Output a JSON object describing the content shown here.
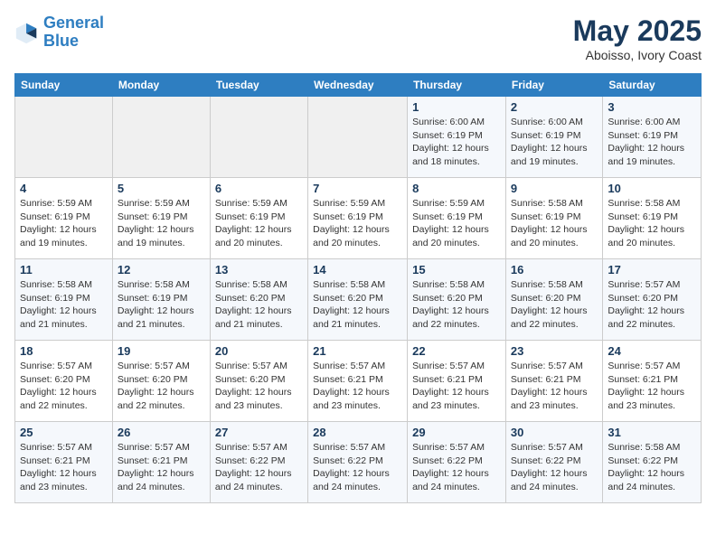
{
  "header": {
    "logo_line1": "General",
    "logo_line2": "Blue",
    "title": "May 2025",
    "subtitle": "Aboisso, Ivory Coast"
  },
  "days_of_week": [
    "Sunday",
    "Monday",
    "Tuesday",
    "Wednesday",
    "Thursday",
    "Friday",
    "Saturday"
  ],
  "weeks": [
    [
      {
        "num": "",
        "info": ""
      },
      {
        "num": "",
        "info": ""
      },
      {
        "num": "",
        "info": ""
      },
      {
        "num": "",
        "info": ""
      },
      {
        "num": "1",
        "info": "Sunrise: 6:00 AM\nSunset: 6:19 PM\nDaylight: 12 hours\nand 18 minutes."
      },
      {
        "num": "2",
        "info": "Sunrise: 6:00 AM\nSunset: 6:19 PM\nDaylight: 12 hours\nand 19 minutes."
      },
      {
        "num": "3",
        "info": "Sunrise: 6:00 AM\nSunset: 6:19 PM\nDaylight: 12 hours\nand 19 minutes."
      }
    ],
    [
      {
        "num": "4",
        "info": "Sunrise: 5:59 AM\nSunset: 6:19 PM\nDaylight: 12 hours\nand 19 minutes."
      },
      {
        "num": "5",
        "info": "Sunrise: 5:59 AM\nSunset: 6:19 PM\nDaylight: 12 hours\nand 19 minutes."
      },
      {
        "num": "6",
        "info": "Sunrise: 5:59 AM\nSunset: 6:19 PM\nDaylight: 12 hours\nand 20 minutes."
      },
      {
        "num": "7",
        "info": "Sunrise: 5:59 AM\nSunset: 6:19 PM\nDaylight: 12 hours\nand 20 minutes."
      },
      {
        "num": "8",
        "info": "Sunrise: 5:59 AM\nSunset: 6:19 PM\nDaylight: 12 hours\nand 20 minutes."
      },
      {
        "num": "9",
        "info": "Sunrise: 5:58 AM\nSunset: 6:19 PM\nDaylight: 12 hours\nand 20 minutes."
      },
      {
        "num": "10",
        "info": "Sunrise: 5:58 AM\nSunset: 6:19 PM\nDaylight: 12 hours\nand 20 minutes."
      }
    ],
    [
      {
        "num": "11",
        "info": "Sunrise: 5:58 AM\nSunset: 6:19 PM\nDaylight: 12 hours\nand 21 minutes."
      },
      {
        "num": "12",
        "info": "Sunrise: 5:58 AM\nSunset: 6:19 PM\nDaylight: 12 hours\nand 21 minutes."
      },
      {
        "num": "13",
        "info": "Sunrise: 5:58 AM\nSunset: 6:20 PM\nDaylight: 12 hours\nand 21 minutes."
      },
      {
        "num": "14",
        "info": "Sunrise: 5:58 AM\nSunset: 6:20 PM\nDaylight: 12 hours\nand 21 minutes."
      },
      {
        "num": "15",
        "info": "Sunrise: 5:58 AM\nSunset: 6:20 PM\nDaylight: 12 hours\nand 22 minutes."
      },
      {
        "num": "16",
        "info": "Sunrise: 5:58 AM\nSunset: 6:20 PM\nDaylight: 12 hours\nand 22 minutes."
      },
      {
        "num": "17",
        "info": "Sunrise: 5:57 AM\nSunset: 6:20 PM\nDaylight: 12 hours\nand 22 minutes."
      }
    ],
    [
      {
        "num": "18",
        "info": "Sunrise: 5:57 AM\nSunset: 6:20 PM\nDaylight: 12 hours\nand 22 minutes."
      },
      {
        "num": "19",
        "info": "Sunrise: 5:57 AM\nSunset: 6:20 PM\nDaylight: 12 hours\nand 22 minutes."
      },
      {
        "num": "20",
        "info": "Sunrise: 5:57 AM\nSunset: 6:20 PM\nDaylight: 12 hours\nand 23 minutes."
      },
      {
        "num": "21",
        "info": "Sunrise: 5:57 AM\nSunset: 6:21 PM\nDaylight: 12 hours\nand 23 minutes."
      },
      {
        "num": "22",
        "info": "Sunrise: 5:57 AM\nSunset: 6:21 PM\nDaylight: 12 hours\nand 23 minutes."
      },
      {
        "num": "23",
        "info": "Sunrise: 5:57 AM\nSunset: 6:21 PM\nDaylight: 12 hours\nand 23 minutes."
      },
      {
        "num": "24",
        "info": "Sunrise: 5:57 AM\nSunset: 6:21 PM\nDaylight: 12 hours\nand 23 minutes."
      }
    ],
    [
      {
        "num": "25",
        "info": "Sunrise: 5:57 AM\nSunset: 6:21 PM\nDaylight: 12 hours\nand 23 minutes."
      },
      {
        "num": "26",
        "info": "Sunrise: 5:57 AM\nSunset: 6:21 PM\nDaylight: 12 hours\nand 24 minutes."
      },
      {
        "num": "27",
        "info": "Sunrise: 5:57 AM\nSunset: 6:22 PM\nDaylight: 12 hours\nand 24 minutes."
      },
      {
        "num": "28",
        "info": "Sunrise: 5:57 AM\nSunset: 6:22 PM\nDaylight: 12 hours\nand 24 minutes."
      },
      {
        "num": "29",
        "info": "Sunrise: 5:57 AM\nSunset: 6:22 PM\nDaylight: 12 hours\nand 24 minutes."
      },
      {
        "num": "30",
        "info": "Sunrise: 5:57 AM\nSunset: 6:22 PM\nDaylight: 12 hours\nand 24 minutes."
      },
      {
        "num": "31",
        "info": "Sunrise: 5:58 AM\nSunset: 6:22 PM\nDaylight: 12 hours\nand 24 minutes."
      }
    ]
  ]
}
